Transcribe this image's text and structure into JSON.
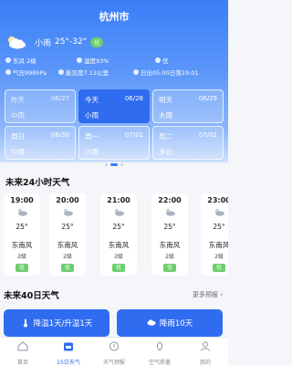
{
  "header": {
    "city": "杭州市"
  },
  "now": {
    "icon": "cloud-moon-icon",
    "condition": "小雨",
    "temp_range": "25°-32°",
    "aqi": "优"
  },
  "info_rows": [
    [
      {
        "icon": "wind-icon",
        "text": "东风 2级"
      },
      {
        "icon": "humidity-icon",
        "text": "湿度93%"
      },
      {
        "icon": "leaf-icon",
        "text": "优"
      }
    ],
    [
      {
        "icon": "pressure-icon",
        "text": "气压998hPa"
      },
      {
        "icon": "eye-icon",
        "text": "能见度7.13公里"
      },
      {
        "icon": "sunrise-icon",
        "text": "日出05:00日落19:01"
      }
    ]
  ],
  "days": [
    {
      "name": "昨天",
      "date": "06/27",
      "weather": "中雨"
    },
    {
      "name": "今天",
      "date": "06/28",
      "weather": "小雨"
    },
    {
      "name": "明天",
      "date": "06/29",
      "weather": "大雨"
    },
    {
      "name": "周日",
      "date": "06/30",
      "weather": "中雨"
    },
    {
      "name": "周一",
      "date": "07/01",
      "weather": "小雨"
    },
    {
      "name": "周二",
      "date": "07/02",
      "weather": "多云"
    }
  ],
  "hourly_title": "未来24小时天气",
  "hourly": [
    {
      "time": "19:00",
      "temp": "25°",
      "wind": "东南风",
      "level": "2级",
      "aqi": "优"
    },
    {
      "time": "20:00",
      "temp": "25°",
      "wind": "东南风",
      "level": "2级",
      "aqi": "优"
    },
    {
      "time": "21:00",
      "temp": "25°",
      "wind": "东南风",
      "level": "2级",
      "aqi": "优"
    },
    {
      "time": "22:00",
      "temp": "25°",
      "wind": "东南风",
      "level": "2级",
      "aqi": "优"
    },
    {
      "time": "23:00",
      "temp": "25°",
      "wind": "东南风",
      "level": "2级",
      "aqi": "优"
    }
  ],
  "forty_title": "未来40日天气",
  "more_label": "更多预报 ›",
  "forecast_cards": [
    {
      "icon": "thermometer-icon",
      "text": "降温1天/升温1天"
    },
    {
      "icon": "rain-cloud-icon",
      "text": "降雨10天"
    }
  ],
  "tabs": [
    {
      "icon": "home-icon",
      "label": "首页"
    },
    {
      "icon": "calendar-icon",
      "label": "15日天气"
    },
    {
      "icon": "alert-icon",
      "label": "天气预报"
    },
    {
      "icon": "air-icon",
      "label": "空气质量"
    },
    {
      "icon": "user-icon",
      "label": "我的"
    }
  ],
  "active_tab": 1
}
